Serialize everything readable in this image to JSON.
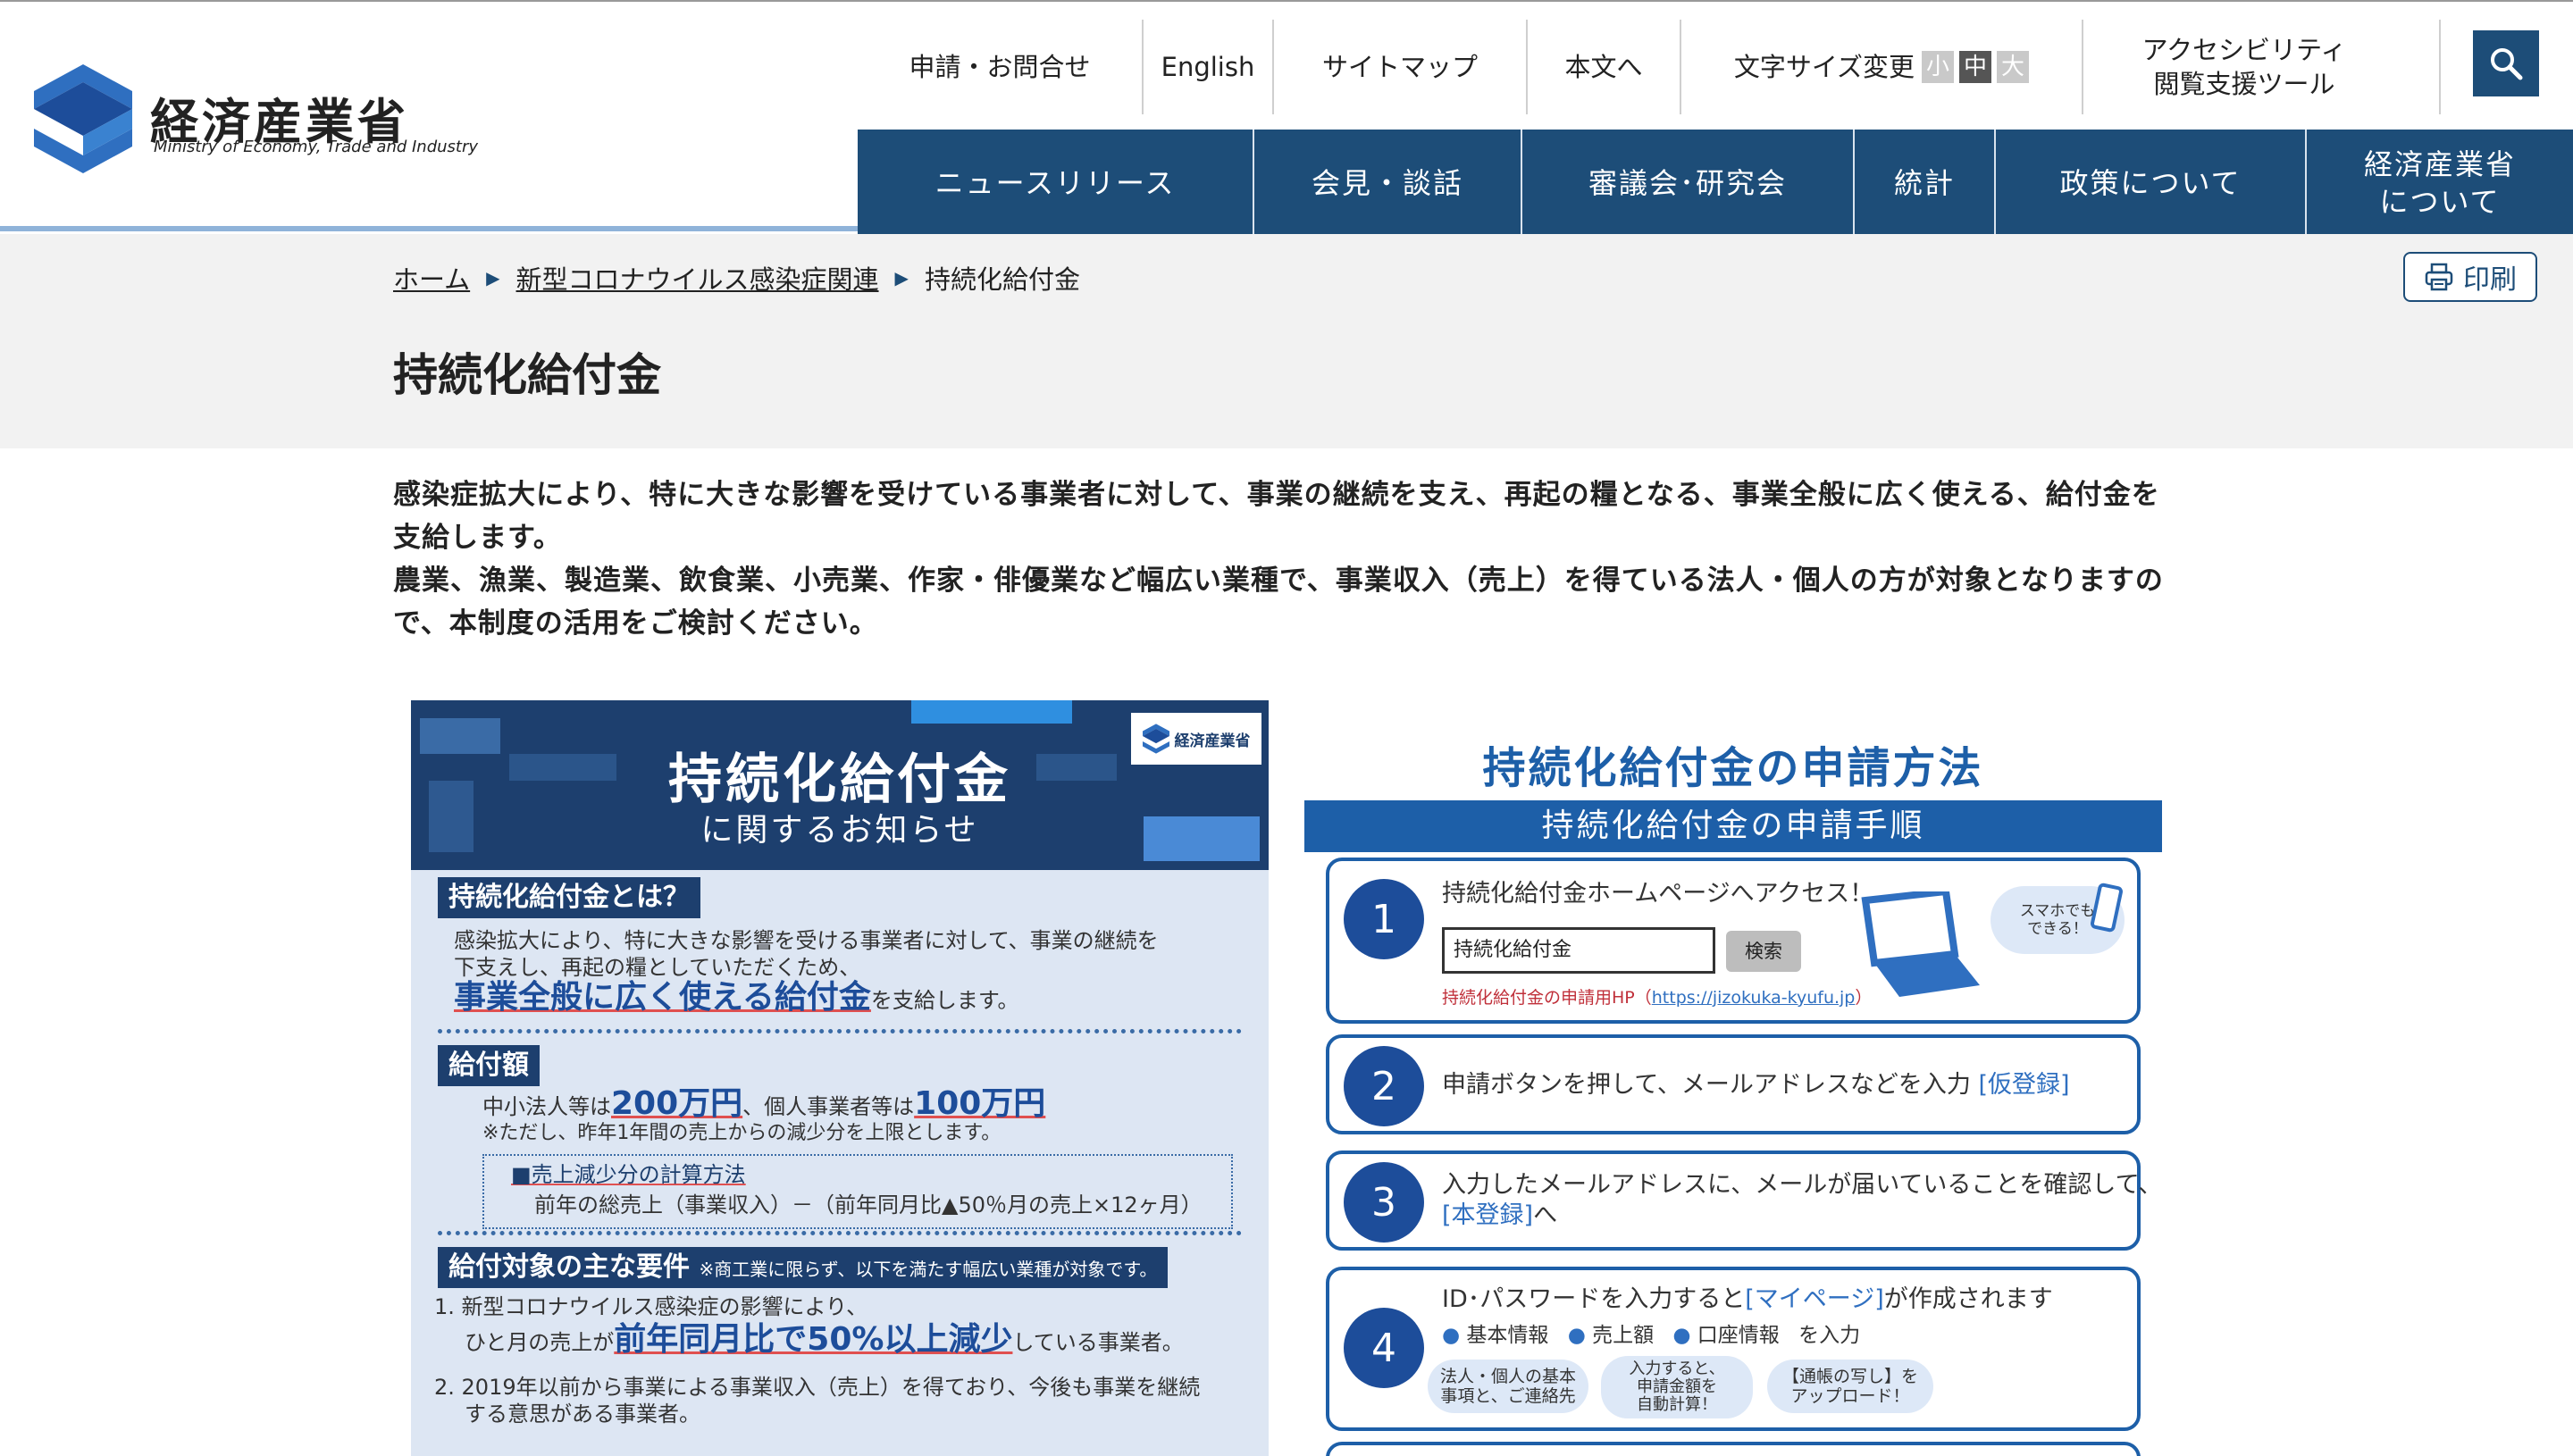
{
  "header": {
    "logo_jp": "経済産業省",
    "logo_en": "Ministry of Economy, Trade and Industry",
    "util_links": [
      "申請・お問合せ",
      "English",
      "サイトマップ",
      "本文へ"
    ],
    "font_size_label": "文字サイズ変更",
    "font_sizes": [
      "小",
      "中",
      "大"
    ],
    "accessibility_line1": "アクセシビリティ",
    "accessibility_line2": "閲覧支援ツール",
    "search_icon": "search-icon",
    "accent_color": "#1d4d78"
  },
  "gnav": {
    "items": [
      "ニュースリリース",
      "会見・談話",
      "審議会･研究会",
      "統計",
      "政策について"
    ],
    "last_line1": "経済産業省",
    "last_line2": "について"
  },
  "breadcrumb": {
    "items": [
      "ホーム",
      "新型コロナウイルス感染症関連",
      "持続化給付金"
    ]
  },
  "print_label": "印刷",
  "page_title": "持続化給付金",
  "intro": {
    "p1": "感染症拡大により、特に大きな影響を受けている事業者に対して、事業の継続を支え、再起の糧となる、事業全般に広く使える、給付金を支給します。",
    "p2": "農業、漁業、製造業、飲食業、小売業、作家・俳優業など幅広い業種で、事業収入（売上）を得ている法人・個人の方が対象となりますので、本制度の活用をご検討ください。"
  },
  "flyer_left": {
    "title": "持続化給付金",
    "subtitle": "に関するお知らせ",
    "badge": "経済産業省",
    "sec1_title": "持続化給付金とは？",
    "sec1_line1": "感染拡大により、特に大きな影響を受ける事業者に対して、事業の継続を",
    "sec1_line2": "下支えし、再起の糧としていただくため、",
    "sec1_big": "事業全般に広く使える給付金",
    "sec1_tail": "を支給します。",
    "sec2_title": "給付額",
    "amount_pre": "中小法人等は",
    "amount_corp": "200万円",
    "amount_mid": "、個人事業者等は",
    "amount_indiv": "100万円",
    "amount_note": "※ただし、昨年1年間の売上からの減少分を上限とします。",
    "calc_title": "■売上減少分の計算方法",
    "calc_formula": "前年の総売上（事業収入）－（前年同月比▲50％月の売上×12ヶ月）",
    "sec3_title": "給付対象の主な要件",
    "sec3_note": "※商工業に限らず、以下を満たす幅広い業種が対象です。",
    "req1_line1": "1. 新型コロナウイルス感染症の影響により、",
    "req1_pre": "ひと月の売上が",
    "req1_big": "前年同月比で50%以上減少",
    "req1_tail": "している事業者。",
    "req2_line1": "2. 2019年以前から事業による事業収入（売上）を得ており、今後も事業を継続",
    "req2_line2": "する意思がある事業者。"
  },
  "flyer_right": {
    "title": "持続化給付金の申請方法",
    "bar": "持続化給付金の申請手順",
    "steps": [
      {
        "num": "1",
        "text": "持続化給付金ホームページへアクセス！"
      },
      {
        "num": "2",
        "text": "申請ボタンを押して、メールアドレスなどを入力",
        "tag": "[仮登録]"
      },
      {
        "num": "3",
        "text": "入力したメールアドレスに、メールが届いていることを確認して、",
        "tag": "[本登録]",
        "tail": "へ"
      },
      {
        "num": "4",
        "text": "ID･パスワードを入力すると",
        "tag": "[マイページ]",
        "tail": "が作成されます"
      }
    ],
    "search_value": "持続化給付金",
    "search_button": "検索",
    "url_label": "持続化給付金の申請用HP（",
    "url": "https://jizokuka-kyufu.jp",
    "url_close": "）",
    "phone_note": "スマホでも\nできる！",
    "step4_items": [
      "基本情報",
      "売上額",
      "口座情報"
    ],
    "step4_tail": "を入力",
    "bubbles": [
      "法人・個人の基本\n事項と、ご連絡先",
      "入力すると、\n申請金額を\n自動計算！",
      "【通帳の写し】を\nアップロード！"
    ]
  }
}
